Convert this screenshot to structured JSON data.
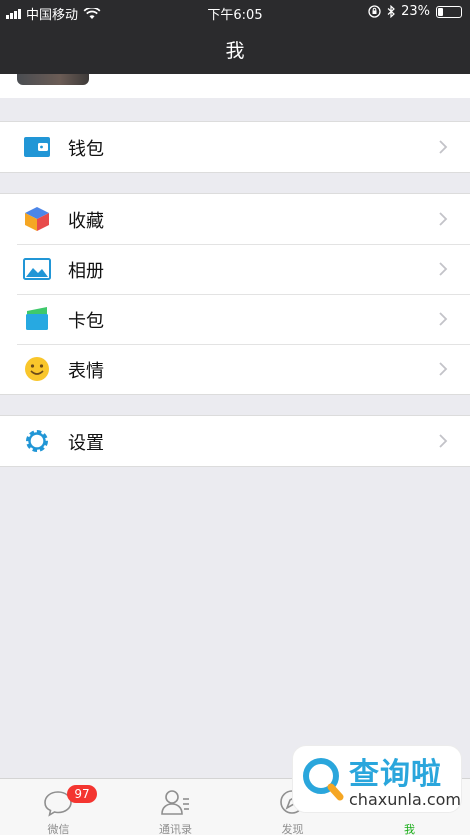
{
  "status_bar": {
    "carrier": "中国移动",
    "time": "下午6:05",
    "battery": "23%",
    "battery_level": 0.23,
    "icons": [
      "signal-icon",
      "wifi-icon",
      "orientation-lock-icon",
      "bluetooth-icon",
      "battery-icon"
    ]
  },
  "nav": {
    "title": "我"
  },
  "groups": [
    {
      "items": [
        {
          "label": "钱包",
          "icon": "wallet-icon"
        }
      ]
    },
    {
      "items": [
        {
          "label": "收藏",
          "icon": "favorites-cube-icon"
        },
        {
          "label": "相册",
          "icon": "album-icon"
        },
        {
          "label": "卡包",
          "icon": "card-wallet-icon"
        },
        {
          "label": "表情",
          "icon": "smiley-icon"
        }
      ]
    },
    {
      "items": [
        {
          "label": "设置",
          "icon": "settings-gear-icon"
        }
      ]
    }
  ],
  "tab_bar": {
    "tabs": [
      {
        "label": "微信",
        "icon": "chat-icon",
        "badge": "97"
      },
      {
        "label": "通讯录",
        "icon": "contacts-icon"
      },
      {
        "label": "发现",
        "icon": "compass-icon"
      },
      {
        "label": "我",
        "icon": "me-icon",
        "active": true
      }
    ]
  },
  "watermark": {
    "title": "查询啦",
    "subtitle": "chaxunla.com"
  },
  "colors": {
    "nav_bg": "#2b2b2d",
    "page_bg": "#ebebf0",
    "accent_green": "#1aad19",
    "badge_red": "#f43530",
    "icon_blue": "#2196d6",
    "smiley_yellow": "#f9c62b"
  }
}
